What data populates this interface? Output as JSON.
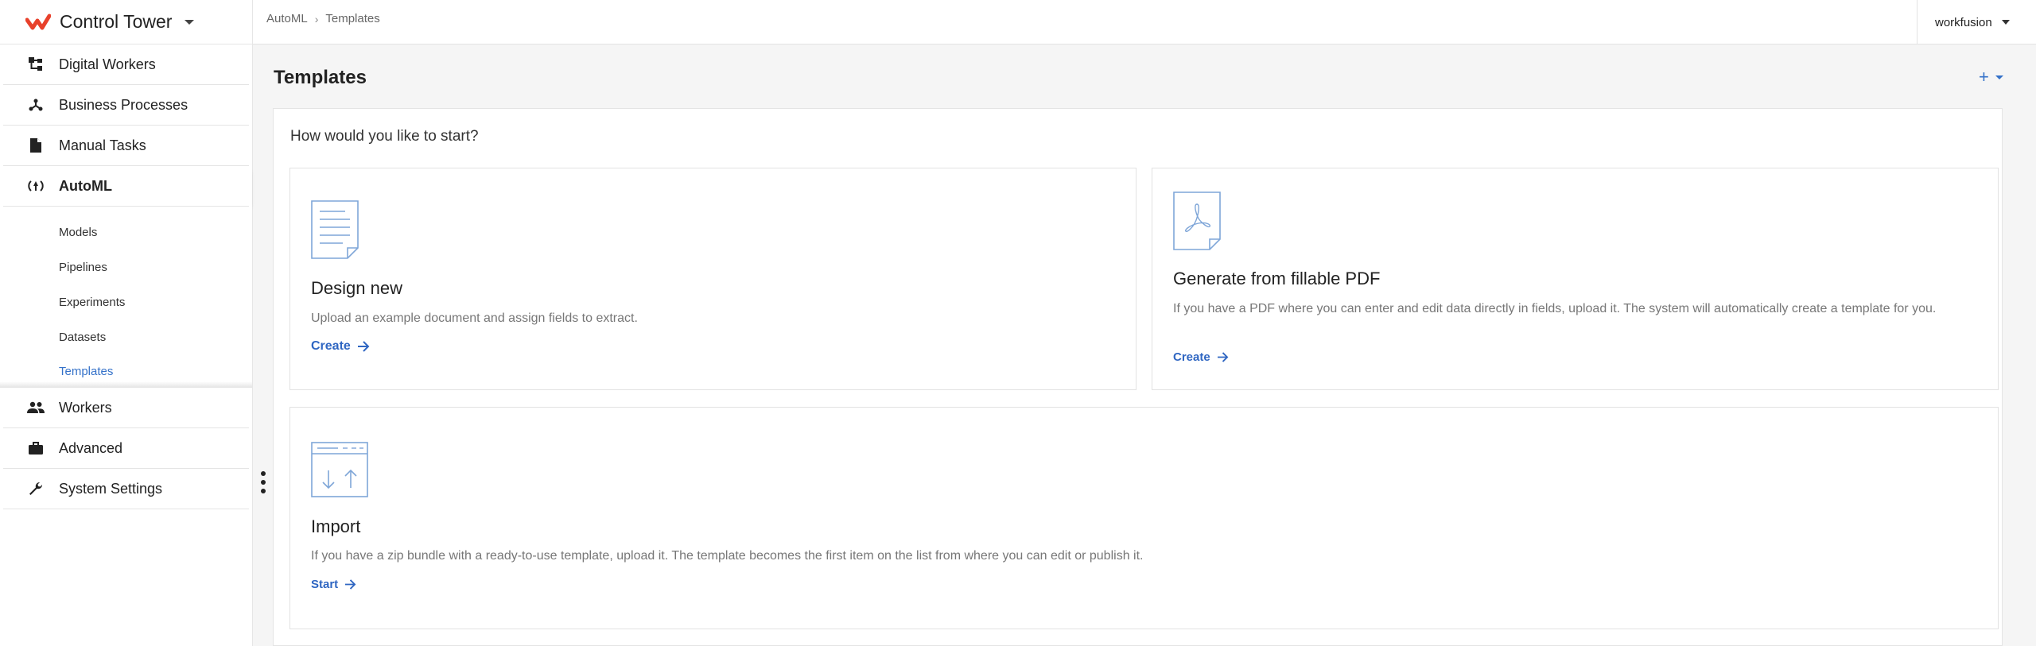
{
  "app": {
    "title": "Control Tower"
  },
  "header": {
    "breadcrumb": [
      "AutoML",
      "Templates"
    ],
    "user": "workfusion"
  },
  "sidebar": {
    "items": [
      {
        "label": "Digital Workers",
        "icon": "digital-workers-icon"
      },
      {
        "label": "Business Processes",
        "icon": "process-icon"
      },
      {
        "label": "Manual Tasks",
        "icon": "document-icon"
      },
      {
        "label": "AutoML",
        "icon": "automl-icon"
      },
      {
        "label": "Workers",
        "icon": "people-icon"
      },
      {
        "label": "Advanced",
        "icon": "briefcase-icon"
      },
      {
        "label": "System Settings",
        "icon": "wrench-icon"
      }
    ],
    "automl_sub": [
      "Models",
      "Pipelines",
      "Experiments",
      "Datasets",
      "Templates"
    ]
  },
  "main": {
    "title": "Templates",
    "add_symbol": "+",
    "question": "How would you like to start?",
    "cards": [
      {
        "title": "Design new",
        "desc": "Upload an example document and assign fields to extract.",
        "action": "Create"
      },
      {
        "title": "Generate from fillable PDF",
        "desc": "If you have a PDF where you can enter and edit data directly in fields, upload it. The system will automatically create a template for you.",
        "action": "Create"
      },
      {
        "title": "Import",
        "desc": "If you have a zip bundle with a ready-to-use template, upload it. The template becomes the first item on the list from where you can edit or publish it.",
        "action": "Start"
      }
    ]
  },
  "colors": {
    "accent": "#3572c9",
    "brand": "#e8412b",
    "icon_line": "#7fa6d8"
  }
}
